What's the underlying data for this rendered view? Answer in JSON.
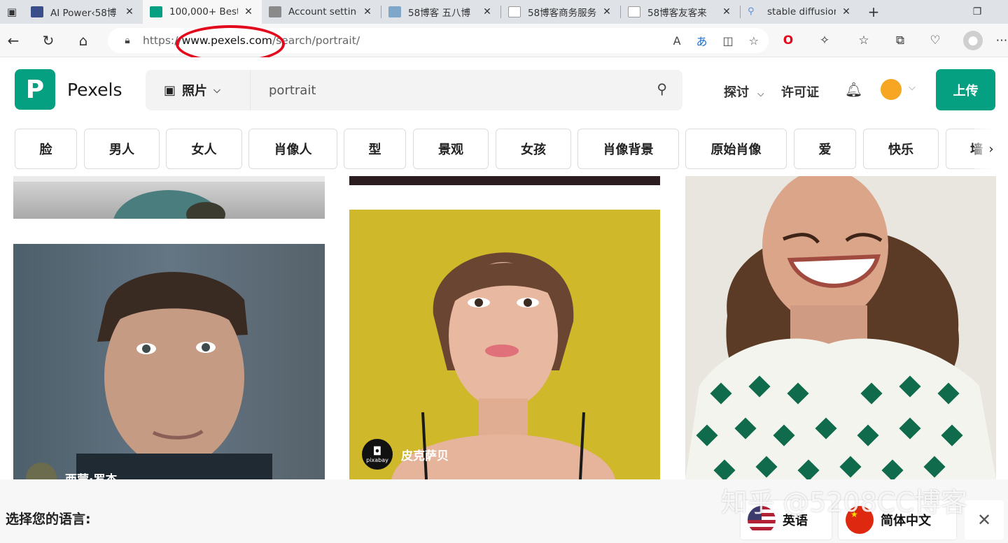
{
  "browser": {
    "tabs": [
      {
        "title": "AI Power‹58博",
        "fav_color": "#3a4f8a"
      },
      {
        "title": "100,000+ Best",
        "fav_color": "#05a081"
      },
      {
        "title": "Account setting",
        "fav_color": "#8a8a8a"
      },
      {
        "title": "58博客 五八博",
        "fav_color": "#7fa7c9"
      },
      {
        "title": "58博客商务服务",
        "fav_color": "#cfcfcf"
      },
      {
        "title": "58博客友客来",
        "fav_color": "#cfcfcf"
      },
      {
        "title": "stable diffusion",
        "fav_color": "#cfe0f5"
      }
    ],
    "new_tab": "+",
    "url_scheme": "https://",
    "url_host": "www.pexels.com",
    "url_path": "/search/portrait/"
  },
  "site": {
    "brand": "Pexels",
    "logo_letter": "P",
    "search_type": "照片",
    "search_value": "portrait",
    "nav_explore": "探讨",
    "nav_license": "许可证",
    "upload": "上传"
  },
  "chips": [
    "脸",
    "男人",
    "女人",
    "肖像人",
    "型",
    "景观",
    "女孩",
    "肖像背景",
    "原始肖像",
    "爱",
    "快乐",
    "墙"
  ],
  "photos": {
    "creator_1": "西蒙·罗杰",
    "creator_2": "皮克萨贝",
    "creator_2_badge": "pixabay"
  },
  "language_bar": {
    "prompt": "选择您的语言:",
    "english": "英语",
    "chinese": "简体中文",
    "close": "✕"
  },
  "watermark": "知乎 @5208CC博客"
}
